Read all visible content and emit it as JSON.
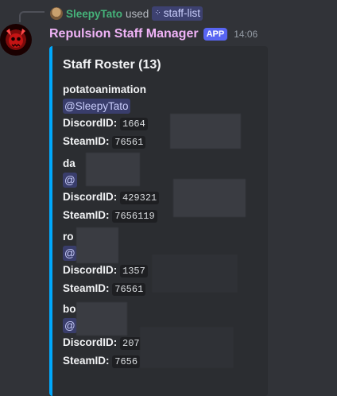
{
  "interaction": {
    "user": "SleepyTato",
    "used_text": "used",
    "command": "staff-list"
  },
  "message": {
    "bot_name": "Repulsion Staff Manager",
    "app_tag": "APP",
    "timestamp": "14:06"
  },
  "embed": {
    "title": "Staff Roster (13)",
    "accent_color": "#00a8fc",
    "staff": [
      {
        "name": "potatoanimation",
        "mention": "@SleepyTato",
        "discord_label": "DiscordID:",
        "discord_id": "1664",
        "steam_label": "SteamID:",
        "steam_id": "76561"
      },
      {
        "name": "da",
        "mention": "@",
        "discord_label": "DiscordID:",
        "discord_id": "429321",
        "steam_label": "SteamID:",
        "steam_id": "7656119"
      },
      {
        "name": "ro",
        "mention": "@",
        "discord_label": "DiscordID:",
        "discord_id": "1357",
        "steam_label": "SteamID:",
        "steam_id": "76561"
      },
      {
        "name": "bo",
        "mention": "@",
        "discord_label": "DiscordID:",
        "discord_id": "207",
        "steam_label": "SteamID:",
        "steam_id": "7656"
      }
    ]
  }
}
